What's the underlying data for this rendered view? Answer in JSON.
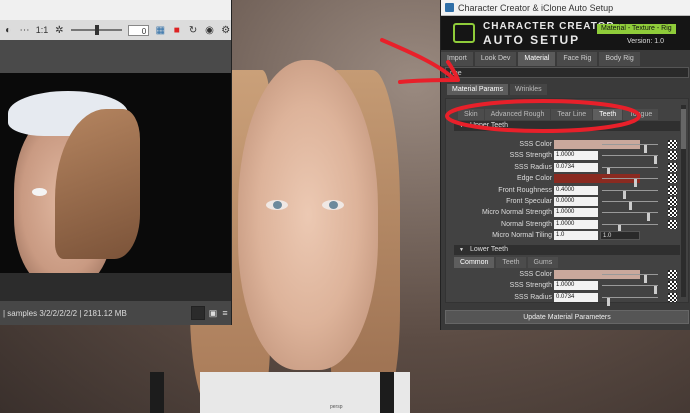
{
  "left_window": {
    "toolbar": {
      "zoom_label": "1:1",
      "slider_value": "0"
    },
    "status_text": "| samples 3/2/2/2/2/2 | 2181.12 MB"
  },
  "right_window": {
    "title": "Character Creator & iClone Auto Setup",
    "banner": {
      "title_line1": "CHARACTER CREATOR",
      "title_line2": "AUTO SETUP",
      "tag": "Material - Texture - Rig",
      "version": "Version: 1.0"
    },
    "main_tabs": [
      {
        "label": "Import",
        "active": false
      },
      {
        "label": "Look Dev",
        "active": false
      },
      {
        "label": "Material",
        "active": true
      },
      {
        "label": "Face Rig",
        "active": false
      },
      {
        "label": "Body Rig",
        "active": false
      }
    ],
    "dropdown_value": "nne",
    "sub_tabs": [
      {
        "label": "Material Params",
        "active": true
      },
      {
        "label": "Wrinkles",
        "active": false
      }
    ],
    "category_tabs": [
      {
        "label": "Skin",
        "active": false
      },
      {
        "label": "Advanced Rough",
        "active": false
      },
      {
        "label": "Tear Line",
        "active": false
      },
      {
        "label": "Teeth",
        "active": true
      },
      {
        "label": "Tongue",
        "active": false
      }
    ],
    "upper_section": "Upper Teeth",
    "upper_params": [
      {
        "label": "SSS Color",
        "type": "color",
        "color": "#c9a89c",
        "knob": 0.8
      },
      {
        "label": "SSS Strength",
        "value": "1.0000",
        "knob": 0.98
      },
      {
        "label": "SSS Radius",
        "value": "0.0734",
        "knob": 0.1
      },
      {
        "label": "Edge Color",
        "type": "color",
        "color": "#8a2a20",
        "knob": 0.6
      },
      {
        "label": "Front Roughness",
        "value": "0.4000",
        "knob": 0.4
      },
      {
        "label": "Front Specular",
        "value": "0.0000",
        "knob": 0.5
      },
      {
        "label": "Micro Normal Strength",
        "value": "1.0000",
        "knob": 0.85
      },
      {
        "label": "Normal Strength",
        "value": "1.0000",
        "knob": 0.3
      },
      {
        "label": "Micro Normal Tiling",
        "value": "1.0",
        "value2": "1.0"
      }
    ],
    "lower_section": "Lower Teeth",
    "lower_tabs": [
      {
        "label": "Common",
        "active": true
      },
      {
        "label": "Teeth",
        "active": false
      },
      {
        "label": "Gums",
        "active": false
      }
    ],
    "lower_params": [
      {
        "label": "SSS Color",
        "type": "color",
        "color": "#c9a89c",
        "knob": 0.8
      },
      {
        "label": "SSS Strength",
        "value": "1.0000",
        "knob": 0.98
      },
      {
        "label": "SSS Radius",
        "value": "0.0734",
        "knob": 0.1
      }
    ],
    "update_button": "Update Material Parameters"
  },
  "annotation_color": "#e8202a",
  "caption": "persp"
}
